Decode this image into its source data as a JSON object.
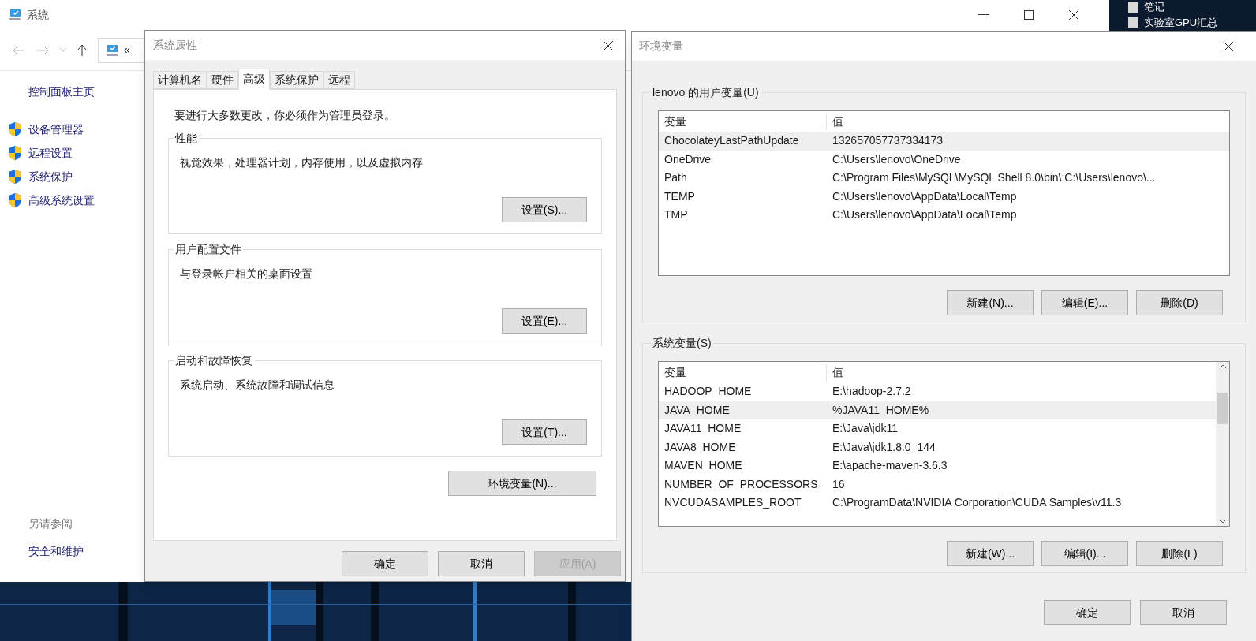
{
  "desktop": {
    "items": [
      "笔记",
      "实验室GPU汇总"
    ]
  },
  "system_window": {
    "title": "系统",
    "address_chevron": "«",
    "sidebar": {
      "home": "控制面板主页",
      "links": [
        "设备管理器",
        "远程设置",
        "系统保护",
        "高级系统设置"
      ],
      "see_also": "另请参阅",
      "see_also_links": [
        "安全和维护"
      ]
    }
  },
  "system_properties": {
    "title": "系统属性",
    "tabs": [
      {
        "label": "计算机名",
        "selected": false
      },
      {
        "label": "硬件",
        "selected": false
      },
      {
        "label": "高级",
        "selected": true
      },
      {
        "label": "系统保护",
        "selected": false
      },
      {
        "label": "远程",
        "selected": false
      }
    ],
    "note": "要进行大多数更改，你必须作为管理员登录。",
    "groups": [
      {
        "title": "性能",
        "text": "视觉效果，处理器计划，内存使用，以及虚拟内存",
        "button": "设置(S)..."
      },
      {
        "title": "用户配置文件",
        "text": "与登录帐户相关的桌面设置",
        "button": "设置(E)..."
      },
      {
        "title": "启动和故障恢复",
        "text": "系统启动、系统故障和调试信息",
        "button": "设置(T)..."
      }
    ],
    "env_button": "环境变量(N)...",
    "buttons": [
      {
        "label": "确定",
        "disabled": false
      },
      {
        "label": "取消",
        "disabled": false
      },
      {
        "label": "应用(A)",
        "disabled": true
      }
    ]
  },
  "environment_variables": {
    "title": "环境变量",
    "user_vars": {
      "title": "lenovo 的用户变量(U)",
      "columns": [
        "变量",
        "值"
      ],
      "rows": [
        {
          "name": "ChocolateyLastPathUpdate",
          "value": "132657057737334173",
          "selected": true
        },
        {
          "name": "OneDrive",
          "value": "C:\\Users\\lenovo\\OneDrive",
          "selected": false
        },
        {
          "name": "Path",
          "value": "C:\\Program Files\\MySQL\\MySQL Shell 8.0\\bin\\;C:\\Users\\lenovo\\...",
          "selected": false
        },
        {
          "name": "TEMP",
          "value": "C:\\Users\\lenovo\\AppData\\Local\\Temp",
          "selected": false
        },
        {
          "name": "TMP",
          "value": "C:\\Users\\lenovo\\AppData\\Local\\Temp",
          "selected": false
        }
      ],
      "buttons": [
        "新建(N)...",
        "编辑(E)...",
        "删除(D)"
      ]
    },
    "system_vars": {
      "title": "系统变量(S)",
      "columns": [
        "变量",
        "值"
      ],
      "rows": [
        {
          "name": "HADOOP_HOME",
          "value": "E:\\hadoop-2.7.2",
          "selected": false
        },
        {
          "name": "JAVA_HOME",
          "value": "%JAVA11_HOME%",
          "selected": true
        },
        {
          "name": "JAVA11_HOME",
          "value": "E:\\Java\\jdk11",
          "selected": false
        },
        {
          "name": "JAVA8_HOME",
          "value": "E:\\Java\\jdk1.8.0_144",
          "selected": false
        },
        {
          "name": "MAVEN_HOME",
          "value": "E:\\apache-maven-3.6.3",
          "selected": false
        },
        {
          "name": "NUMBER_OF_PROCESSORS",
          "value": "16",
          "selected": false
        },
        {
          "name": "NVCUDASAMPLES_ROOT",
          "value": "C:\\ProgramData\\NVIDIA Corporation\\CUDA Samples\\v11.3",
          "selected": false
        }
      ],
      "buttons": [
        "新建(W)...",
        "编辑(I)...",
        "删除(L)"
      ]
    },
    "buttons": [
      "确定",
      "取消"
    ]
  }
}
